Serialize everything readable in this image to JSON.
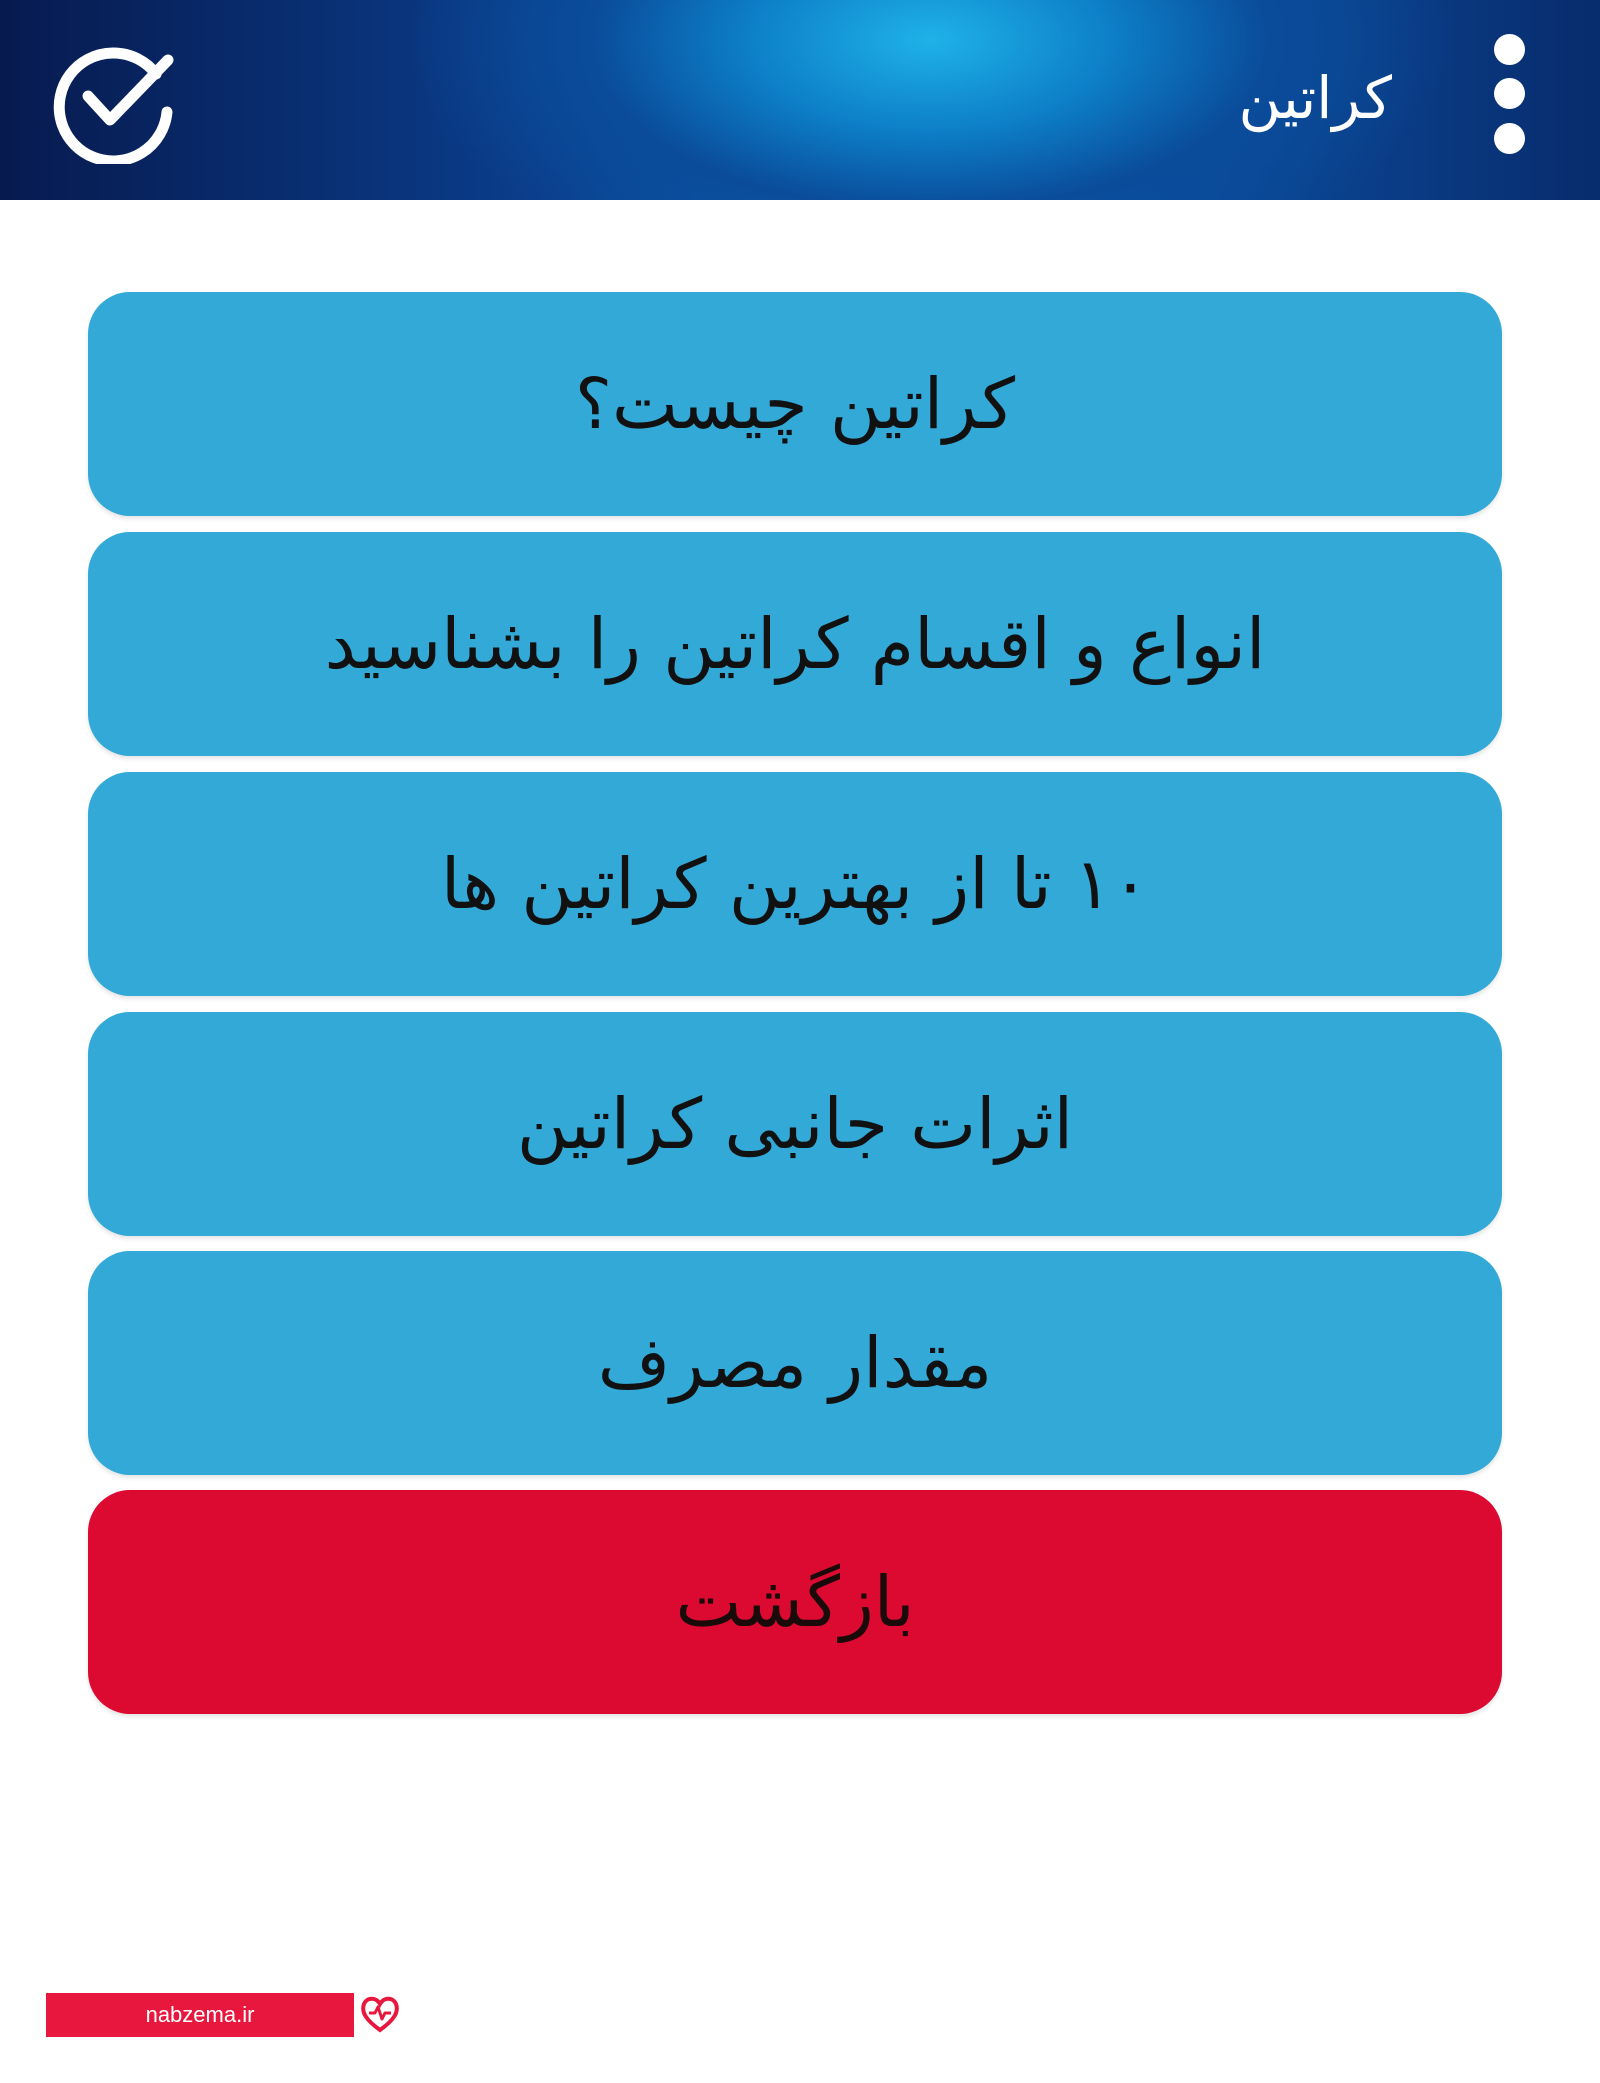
{
  "header": {
    "title": "کراتین",
    "menu_icon": "more-vertical-icon",
    "check_icon": "check-circle-icon"
  },
  "menu": {
    "items": [
      {
        "label": "کراتین چیست؟"
      },
      {
        "label": "انواع و اقسام کراتین را بشناسید"
      },
      {
        "label": "۱۰ تا از بهترین کراتین ها"
      },
      {
        "label": "اثرات جانبی کراتین"
      },
      {
        "label": "مقدار مصرف"
      }
    ],
    "back_label": "بازگشت"
  },
  "colors": {
    "item_background": "#33a9d8",
    "back_background": "#dc0a31",
    "watermark": "#e8173e"
  },
  "watermark": {
    "text": "nabzema.ir",
    "icon": "heart-pulse-icon"
  }
}
